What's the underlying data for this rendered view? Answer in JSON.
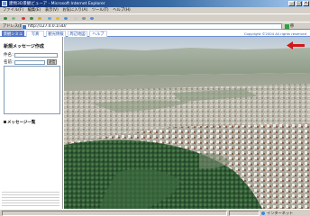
{
  "window": {
    "title": "建物3D景観ビューア - Microsoft Internet Explorer"
  },
  "menu": [
    "ファイル(F)",
    "編集(E)",
    "表示(V)",
    "お気に入り(A)",
    "ツール(T)",
    "ヘルプ(H)"
  ],
  "toolbar_icons": [
    "back-icon",
    "forward-icon",
    "stop-icon",
    "refresh-icon",
    "home-icon",
    "search-icon",
    "favorites-icon",
    "history-icon",
    "mail-icon",
    "print-icon",
    "edit-icon"
  ],
  "address": {
    "label": "アドレス(D)",
    "url": "http://127.0.0.1/3D/",
    "go_label": "移動"
  },
  "tabs": [
    {
      "label": "景観シミュ",
      "active": true
    },
    {
      "label": "写真",
      "active": false
    },
    {
      "label": "観光情報",
      "active": false
    },
    {
      "label": "周辺地図",
      "active": false
    },
    {
      "label": "ヘルプ",
      "active": false
    }
  ],
  "copyright": "Copyright ©2004 All rights reserved",
  "panel": {
    "title": "新規メッセージ作成",
    "name_label": "件名：",
    "from_label": "名前：",
    "send_label": "送信",
    "list_title": "メッセージ一覧"
  },
  "status": {
    "zone": "インターネット"
  },
  "colors": {
    "titlebar": "#0a246a",
    "tab_active": "#5778c9",
    "chrome": "#d4d0c8",
    "compass": "#d01818"
  }
}
